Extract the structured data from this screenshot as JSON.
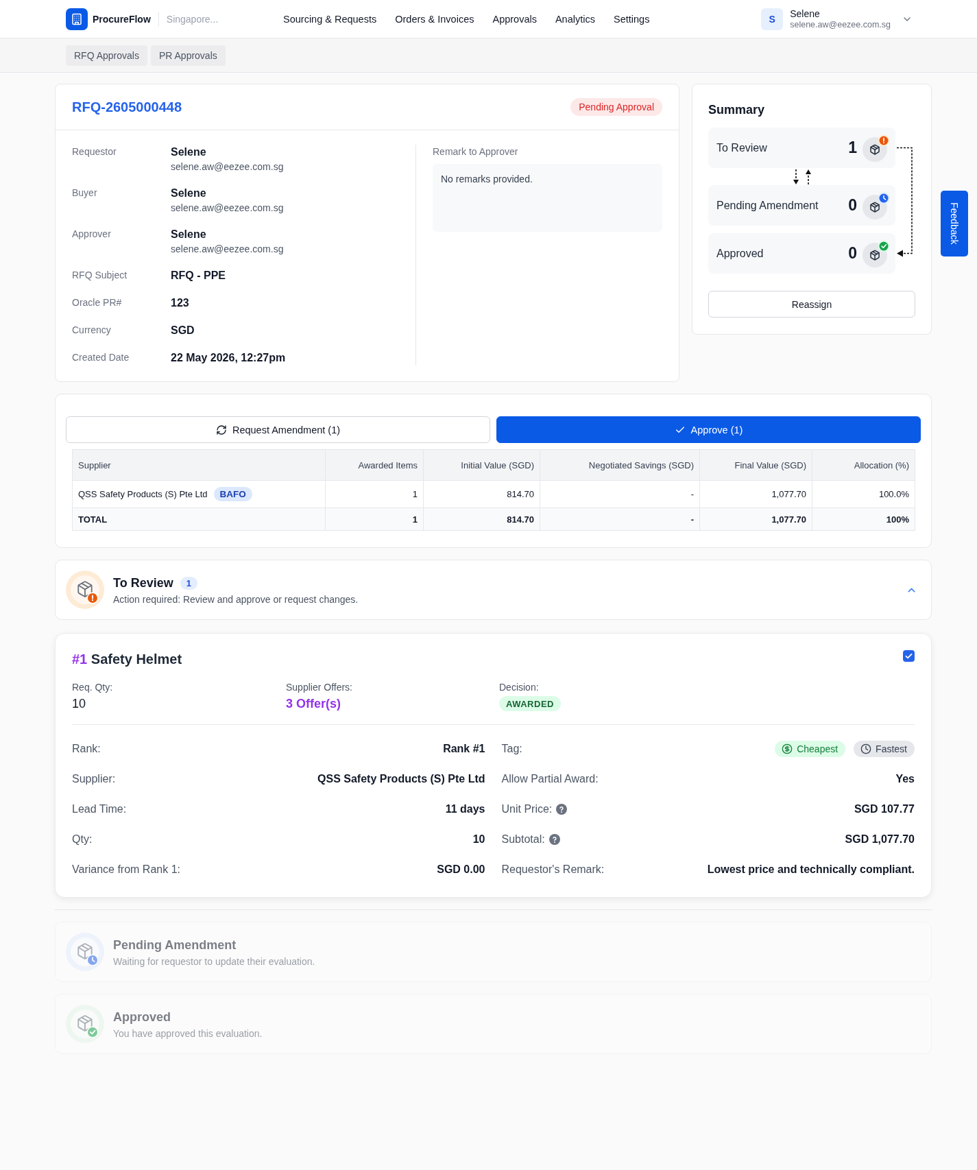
{
  "header": {
    "brand": "ProcureFlow",
    "location": "Singapore...",
    "nav": [
      {
        "label": "Sourcing & Requests"
      },
      {
        "label": "Orders & Invoices"
      },
      {
        "label": "Approvals"
      },
      {
        "label": "Analytics"
      },
      {
        "label": "Settings"
      }
    ],
    "user": {
      "initial": "S",
      "name": "Selene",
      "email": "selene.aw@eezee.com.sg"
    }
  },
  "subnav": {
    "tabs": [
      {
        "label": "RFQ Approvals"
      },
      {
        "label": "PR Approvals"
      }
    ]
  },
  "rfq": {
    "id": "RFQ-2605000448",
    "status": {
      "label": "Pending Approval",
      "kind": "pending"
    },
    "fields": [
      {
        "kind": "person",
        "label": "Requestor",
        "value": "Selene",
        "email": "selene.aw@eezee.com.sg"
      },
      {
        "kind": "person",
        "label": "Buyer",
        "value": "Selene",
        "email": "selene.aw@eezee.com.sg"
      },
      {
        "kind": "person",
        "label": "Approver",
        "value": "Selene",
        "email": "selene.aw@eezee.com.sg"
      },
      {
        "kind": "text",
        "label": "RFQ Subject",
        "value": "RFQ - PPE"
      },
      {
        "kind": "text",
        "label": "Oracle PR#",
        "value": "123"
      },
      {
        "kind": "text",
        "label": "Currency",
        "value": "SGD"
      },
      {
        "kind": "text",
        "label": "Created Date",
        "value": "22 May 2026, 12:27pm"
      }
    ],
    "remark": {
      "label": "Remark to Approver",
      "text": "No remarks provided."
    }
  },
  "summary": {
    "title": "Summary",
    "stages": [
      {
        "kind": "review",
        "label": "To Review",
        "count": "1"
      },
      {
        "kind": "amendment",
        "label": "Pending Amendment",
        "count": "0"
      },
      {
        "kind": "approved",
        "label": "Approved",
        "count": "0"
      }
    ],
    "reassign": "Reassign"
  },
  "feedback": {
    "label": "Feedback"
  },
  "actions": {
    "buttons": [
      {
        "kind": "amend",
        "label": "Request Amendment (1)"
      },
      {
        "kind": "approve",
        "label": "Approve (1)"
      }
    ]
  },
  "allocation_table": {
    "columns": [
      "Supplier",
      "Awarded Items",
      "Initial Value (SGD)",
      "Negotiated Savings (SGD)",
      "Final Value (SGD)",
      "Allocation (%)"
    ],
    "rows": [
      {
        "kind": "supplier",
        "badge": "BAFO",
        "cells": [
          "QSS Safety Products (S) Pte Ltd",
          "1",
          "814.70",
          "-",
          "1,077.70",
          "100.0%"
        ]
      },
      {
        "kind": "total",
        "cells": [
          "TOTAL",
          "1",
          "814.70",
          "-",
          "1,077.70",
          "100%"
        ]
      }
    ]
  },
  "sections": [
    {
      "kind": "review",
      "title": "To Review",
      "count": "1",
      "subtitle": "Action required: Review and approve or request changes.",
      "disabled": false,
      "expanded": true,
      "items": [
        {
          "index": "#1",
          "title": "Safety Helmet",
          "checked": true,
          "overview": [
            {
              "kind": "number",
              "label": "Req. Qty:",
              "value": "10"
            },
            {
              "kind": "link",
              "label": "Supplier Offers:",
              "value": "3 Offer(s)"
            },
            {
              "kind": "badge",
              "label": "Decision:",
              "value": "AWARDED"
            }
          ],
          "details": [
            {
              "kind": "text",
              "label": "Rank:",
              "value": "Rank #1",
              "help": false
            },
            {
              "kind": "tags",
              "label": "Tag:",
              "help": false,
              "tags": [
                {
                  "kind": "cheapest",
                  "label": "Cheapest"
                },
                {
                  "kind": "fastest",
                  "label": "Fastest"
                }
              ]
            },
            {
              "kind": "text",
              "label": "Supplier:",
              "value": "QSS Safety Products (S) Pte Ltd",
              "help": false
            },
            {
              "kind": "text",
              "label": "Allow Partial Award:",
              "value": "Yes",
              "help": false
            },
            {
              "kind": "text",
              "label": "Lead Time:",
              "value": "11 days",
              "help": false
            },
            {
              "kind": "text",
              "label": "Unit Price:",
              "value": "SGD 107.77",
              "help": true
            },
            {
              "kind": "text",
              "label": "Qty:",
              "value": "10",
              "help": false
            },
            {
              "kind": "text",
              "label": "Subtotal:",
              "value": "SGD 1,077.70",
              "help": true
            },
            {
              "kind": "text",
              "label": "Variance from Rank 1:",
              "value": "SGD 0.00",
              "help": false
            },
            {
              "kind": "text",
              "label": "Requestor's Remark:",
              "value": "Lowest price and technically compliant.",
              "help": false
            }
          ]
        }
      ]
    },
    {
      "kind": "amendment",
      "title": "Pending Amendment",
      "subtitle": "Waiting for requestor to update their evaluation.",
      "disabled": true
    },
    {
      "kind": "approved",
      "title": "Approved",
      "subtitle": "You have approved this evaluation.",
      "disabled": true
    }
  ]
}
